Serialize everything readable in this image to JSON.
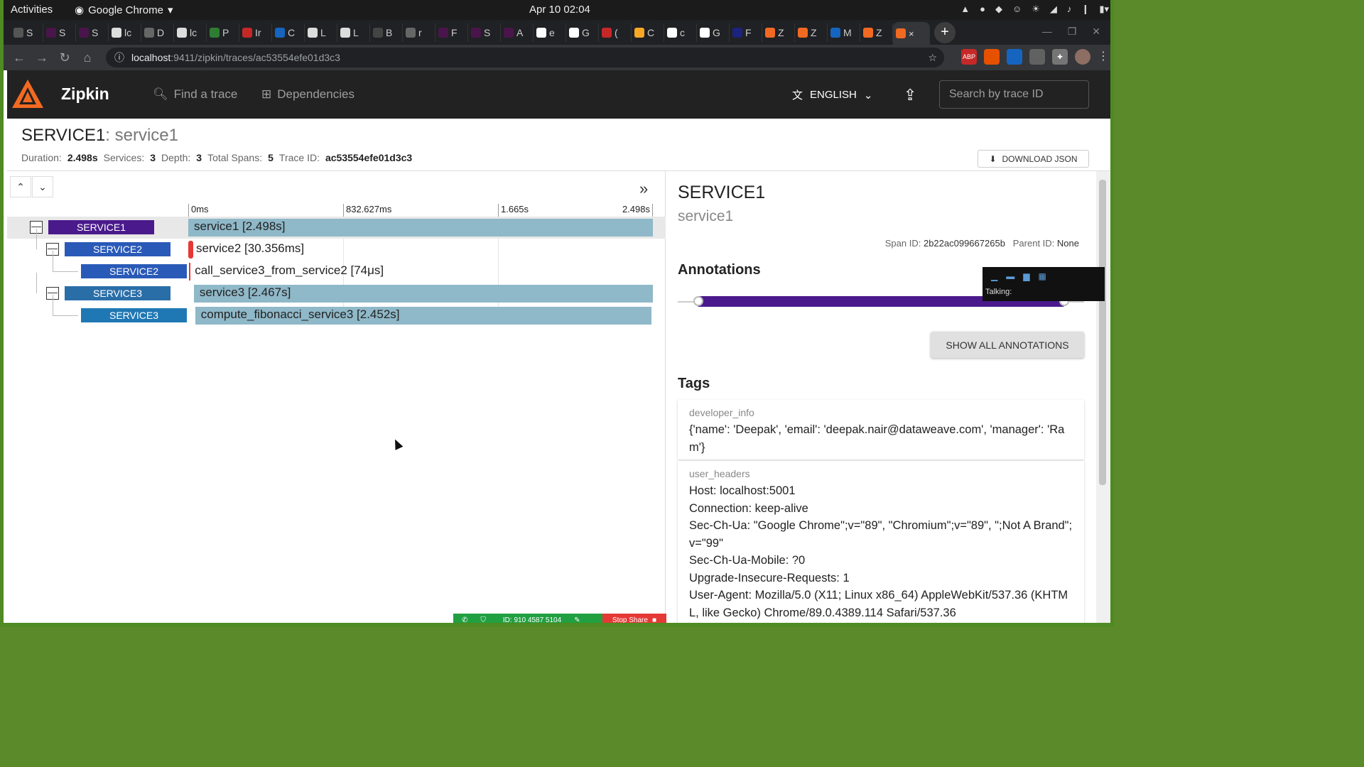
{
  "gnome": {
    "activities": "Activities",
    "app": "Google Chrome",
    "clock": "Apr 10  02:04"
  },
  "tabs": [
    {
      "label": "S"
    },
    {
      "label": "S"
    },
    {
      "label": "S"
    },
    {
      "label": "lc"
    },
    {
      "label": "D"
    },
    {
      "label": "lc"
    },
    {
      "label": "P"
    },
    {
      "label": "Ir"
    },
    {
      "label": "C"
    },
    {
      "label": "L"
    },
    {
      "label": "L"
    },
    {
      "label": "B"
    },
    {
      "label": "r"
    },
    {
      "label": "F"
    },
    {
      "label": "S"
    },
    {
      "label": "A"
    },
    {
      "label": "e"
    },
    {
      "label": "G"
    },
    {
      "label": "("
    },
    {
      "label": "C"
    },
    {
      "label": "c"
    },
    {
      "label": "G"
    },
    {
      "label": "F"
    },
    {
      "label": "Z"
    },
    {
      "label": "Z"
    },
    {
      "label": "M"
    },
    {
      "label": "Z"
    },
    {
      "label": "×"
    }
  ],
  "address": {
    "host": "localhost",
    "path": ":9411/zipkin/traces/ac53554efe01d3c3"
  },
  "extensions": [
    "ABP",
    "",
    "",
    "",
    "",
    ""
  ],
  "zipkin": {
    "brand": "Zipkin",
    "nav_find": "Find a trace",
    "nav_deps": "Dependencies",
    "language": "ENGLISH",
    "search_placeholder": "Search by trace ID"
  },
  "trace": {
    "service": "SERVICE1",
    "separator": ": ",
    "span": "service1",
    "duration_label": "Duration:",
    "duration": "2.498s",
    "services_label": "Services:",
    "services": "3",
    "depth_label": "Depth:",
    "depth": "3",
    "total_label": "Total Spans:",
    "total": "5",
    "traceid_label": "Trace ID:",
    "traceid": "ac53554efe01d3c3",
    "download": "DOWNLOAD JSON"
  },
  "timeline": {
    "ticks": [
      "0ms",
      "832.627ms",
      "1.665s",
      "2.498s"
    ],
    "rows": [
      {
        "service": "SERVICE1",
        "label": "service1 [2.498s]",
        "color": "#4a1a8c",
        "start": 0,
        "end": 1
      },
      {
        "service": "SERVICE2",
        "label": "service2 [30.356ms]",
        "color": "#2a5ab8",
        "start": 0,
        "end": 0.012
      },
      {
        "service": "SERVICE2",
        "label": "call_service3_from_service2 [74μs]",
        "color": "#2a5ab8",
        "start": 0.002,
        "end": 0.0023
      },
      {
        "service": "SERVICE3",
        "label": "service3 [2.467s]",
        "color": "#2a6ea8",
        "start": 0.012,
        "end": 1
      },
      {
        "service": "SERVICE3",
        "label": "compute_fibonacci_service3 [2.452s]",
        "color": "#1f78b4",
        "start": 0.015,
        "end": 0.997
      }
    ]
  },
  "detail": {
    "service": "SERVICE1",
    "span": "service1",
    "span_id_label": "Span ID:",
    "span_id": "2b22ac099667265b",
    "parent_id_label": "Parent ID:",
    "parent_id": "None",
    "annotations": "Annotations",
    "show_all": "SHOW ALL ANNOTATIONS",
    "tags": "Tags",
    "tag1_key": "developer_info",
    "tag1_val": "{'name': 'Deepak', 'email': 'deepak.nair@dataweave.com', 'manager': 'Ram'}",
    "tag2_key": "user_headers",
    "tag2_lines": [
      "Host: localhost:5001",
      "Connection: keep-alive",
      "Sec-Ch-Ua: \"Google Chrome\";v=\"89\", \"Chromium\";v=\"89\", \";Not A Brand\";v=\"99\"",
      "Sec-Ch-Ua-Mobile: ?0",
      "Upgrade-Insecure-Requests: 1",
      "User-Agent: Mozilla/5.0 (X11; Linux x86_64) AppleWebKit/537.36 (KHTML, like Gecko) Chrome/89.0.4389.114 Safari/537.36"
    ]
  },
  "meeting": {
    "talking": "Talking:",
    "id": "ID: 910 4587 5104",
    "stop": "Stop Share"
  }
}
